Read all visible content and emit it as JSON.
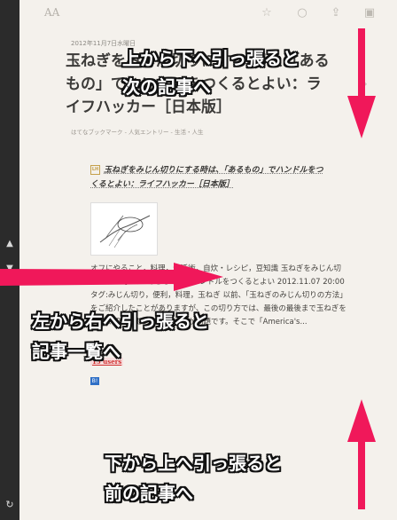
{
  "sidebar": {
    "up_icon": "▲",
    "down_icon": "▼",
    "refresh_icon": "↻"
  },
  "toolbar": {
    "font_size_label": "AA",
    "star_icon": "☆",
    "circle_icon": "○",
    "share_icon": "⇪",
    "save_icon": "▣"
  },
  "article": {
    "meta": "2012年11月7日水曜日",
    "headline": "玉ねぎをみじん切りにする時は、「あるもの」でハンドルをつくるとよい：ライフハッカー［日本版］",
    "tags": "はてなブックマーク - 人気エントリー - 生活・人生",
    "card_icon": "LH",
    "card_title": "玉ねぎをみじん切りにする時は、「あるもの」でハンドルをつくるとよい：ライフハッカー［日本版］",
    "excerpt": "オフにやること，料理，生活術，自炊・レシピ，豆知識 玉ねぎをみじん切りにする時は、「あるもの」でハンドルをつくるとよい 2012.11.07 20:00 タグ:みじん切り，便利，料理，玉ねぎ 以前、「玉ねぎのみじん切りの方法」をご紹介したことがありますが、この切り方では、最後の最後まで玉ねぎを細かく切り刻むのが難しいのが問題です。そこで「America's...",
    "users_badge": "15 users",
    "hatena_icon": "B!"
  },
  "overlay": {
    "top_text": "上から下へ引っ張ると",
    "top_text2": "次の記事へ",
    "left_text": "左から右へ引っ張ると",
    "left_text2": "記事一覧へ",
    "bottom_text": "下から上へ引っ張ると",
    "bottom_text2": "前の記事へ",
    "arrow_color": "#f0185a"
  }
}
